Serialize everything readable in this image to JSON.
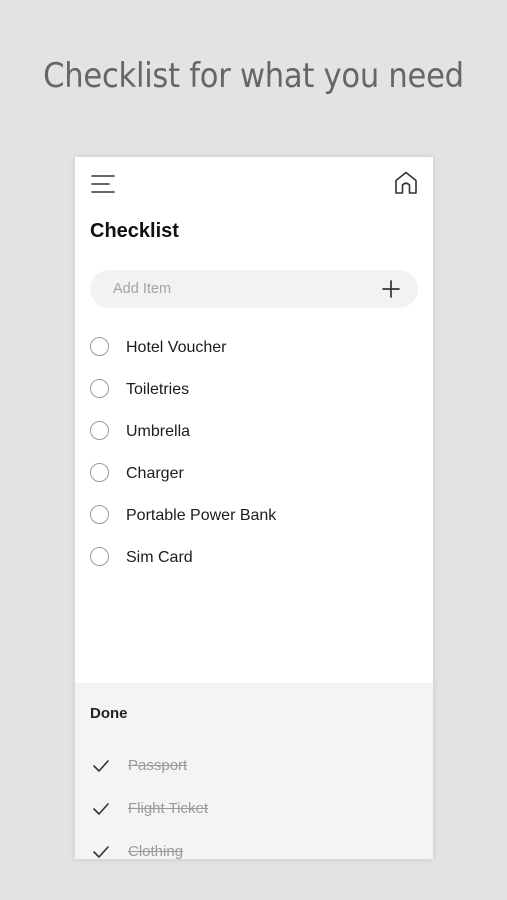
{
  "tagline": "Checklist for what you need",
  "header": {
    "menu_icon": "hamburger-menu-icon",
    "home_icon": "home-icon"
  },
  "title": "Checklist",
  "add_item": {
    "placeholder": "Add Item",
    "value": "",
    "add_icon": "plus-icon"
  },
  "items": [
    {
      "label": "Hotel Voucher",
      "checked": false
    },
    {
      "label": "Toiletries",
      "checked": false
    },
    {
      "label": "Umbrella",
      "checked": false
    },
    {
      "label": "Charger",
      "checked": false
    },
    {
      "label": "Portable Power Bank",
      "checked": false
    },
    {
      "label": "Sim Card",
      "checked": false
    }
  ],
  "done": {
    "title": "Done",
    "items": [
      {
        "label": "Passport",
        "checked": true
      },
      {
        "label": "Flight Ticket",
        "checked": true
      },
      {
        "label": "Clothing",
        "checked": true
      }
    ]
  },
  "colors": {
    "background": "#e3e3e3",
    "card": "#ffffff",
    "done_background": "#f3f4f6",
    "input_background": "#f2f2f2",
    "done_text": "#9a9a9a"
  }
}
